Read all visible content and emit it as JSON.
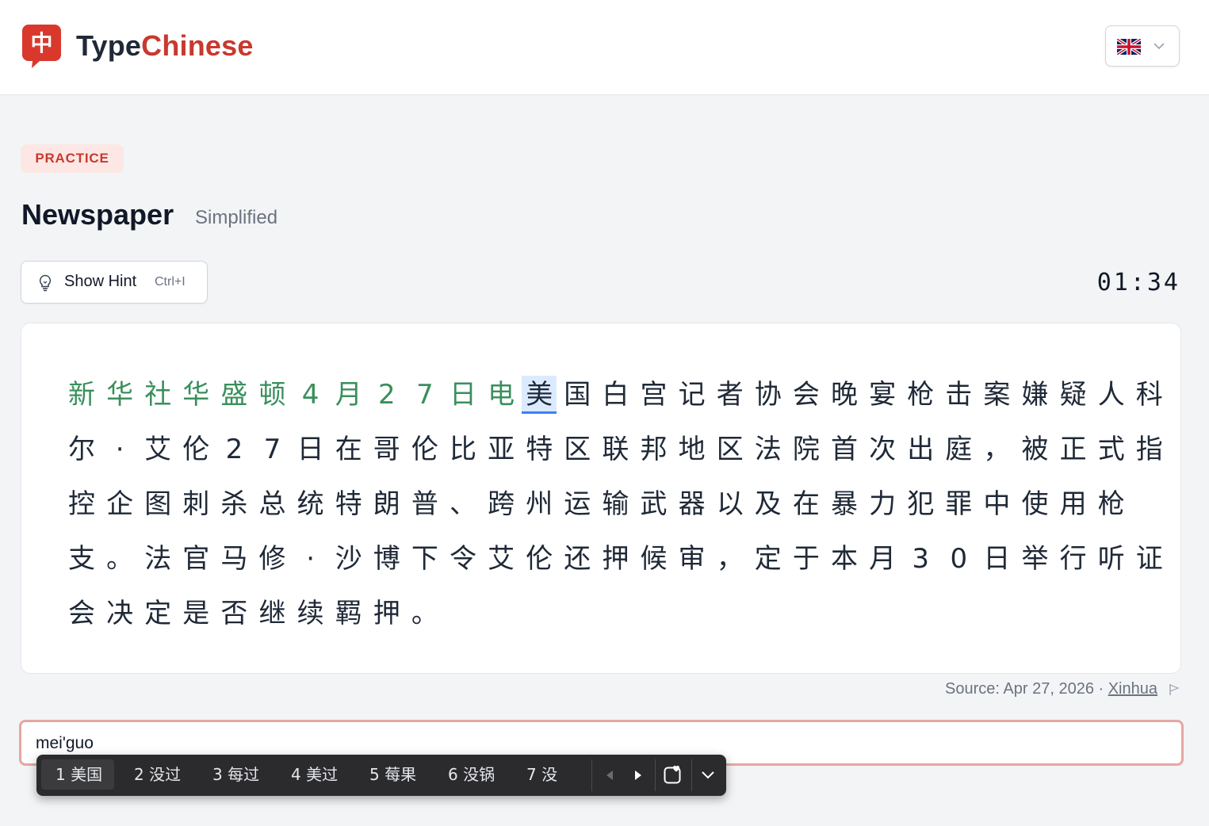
{
  "header": {
    "logo_char": "中",
    "brand_part1": "Type",
    "brand_part2": "Chinese",
    "language_flag": "uk-flag-icon"
  },
  "page": {
    "badge": "PRACTICE",
    "title": "Newspaper",
    "subtitle": "Simplified",
    "hint_label": "Show Hint",
    "hint_shortcut": "Ctrl+I",
    "timer": "01:34"
  },
  "passage": {
    "done_count": 12,
    "current_index": 12,
    "lines": [
      "新华社华盛顿4月27日电美国白宫记者协会晚宴枪击案嫌疑人科",
      "尔·艾伦27日在哥伦比亚特区联邦地区法院首次出庭，被正式指",
      "控企图刺杀总统特朗普、跨州运输武器以及在暴力犯罪中使用枪",
      "支。法官马修·沙博下令艾伦还押候审，定于本月30日举行听证",
      "会决定是否继续羁押。"
    ]
  },
  "source": {
    "prefix": "Source: Apr 27, 2026 · ",
    "link": "Xinhua"
  },
  "input": {
    "value": "mei'guo"
  },
  "ime": {
    "candidates": [
      "1 美国",
      "2 没过",
      "3 每过",
      "4 美过",
      "5 莓果",
      "6 没锅",
      "7 没"
    ]
  },
  "colors": {
    "accent": "#c8392e",
    "done": "#3a8f5c",
    "current_bg": "#dbeafe",
    "input_border": "#e5a7a3"
  }
}
